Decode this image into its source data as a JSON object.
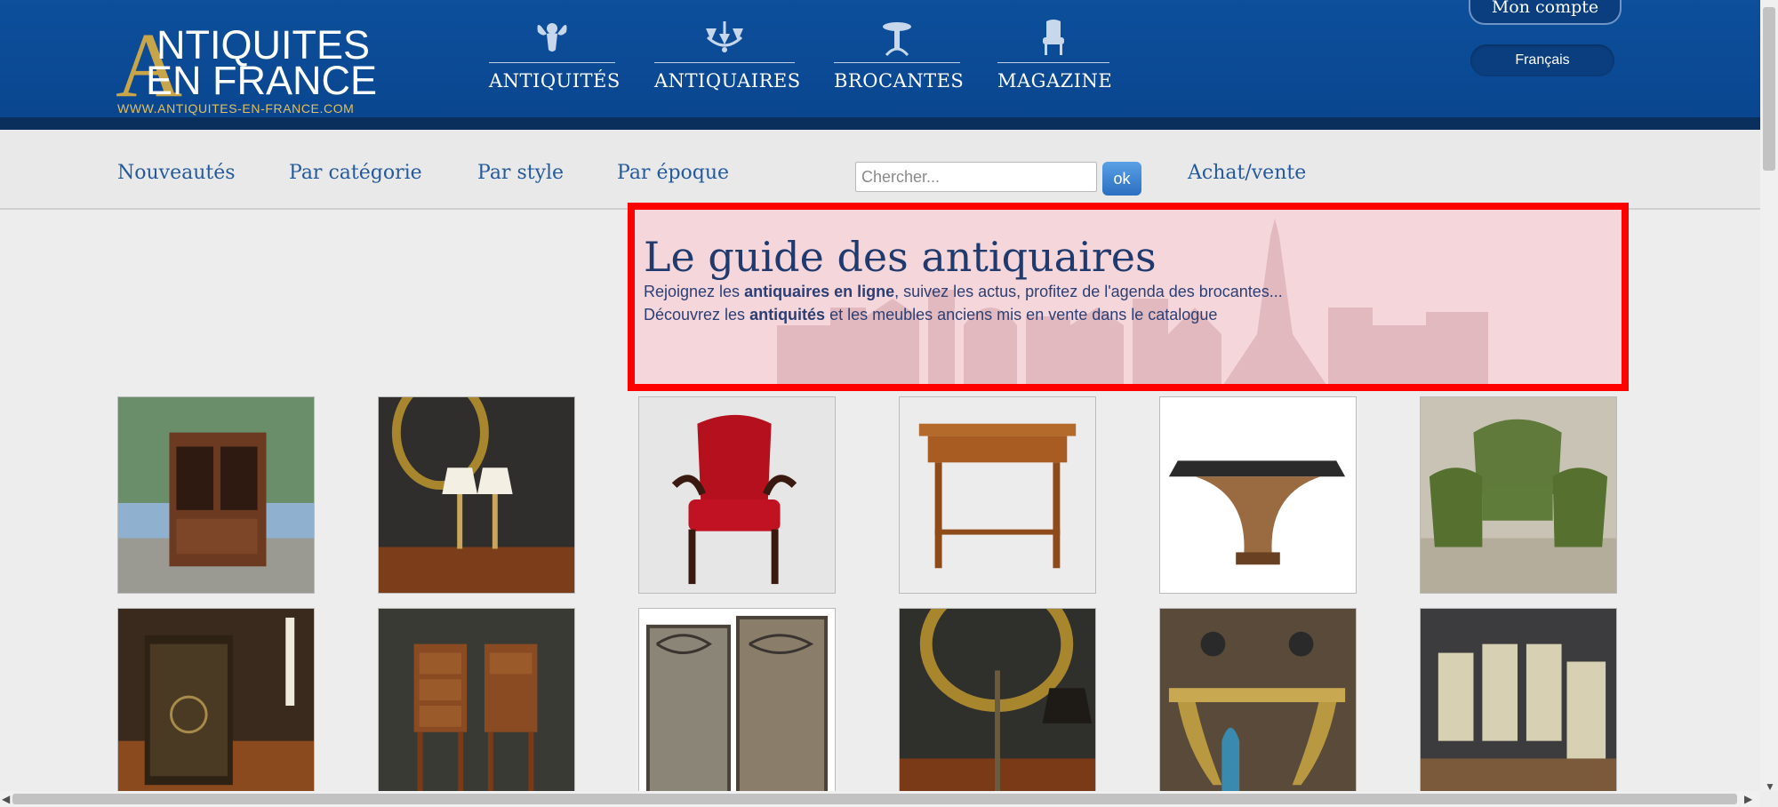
{
  "header": {
    "logo": {
      "letter": "A",
      "line1": "NTIQUITES",
      "line2": "EN FRANCE",
      "url": "WWW.ANTIQUITES-EN-FRANCE.COM"
    },
    "nav": [
      {
        "label": "ANTIQUITÉS",
        "icon": "cherub-icon"
      },
      {
        "label": "ANTIQUAIRES",
        "icon": "chandelier-icon"
      },
      {
        "label": "BROCANTES",
        "icon": "pedestal-table-icon"
      },
      {
        "label": "MAGAZINE",
        "icon": "armchair-icon"
      }
    ],
    "account_label": "Mon compte",
    "language_label": "Français"
  },
  "subnav": {
    "items": [
      "Nouveautés",
      "Par catégorie",
      "Par style",
      "Par époque"
    ],
    "search_placeholder": "Chercher...",
    "search_button": "ok",
    "achat_vente": "Achat/vente"
  },
  "hero": {
    "title": "Le guide des antiquaires",
    "line1_pre": "Rejoignez les ",
    "line1_bold": "antiquaires en ligne",
    "line1_post": ", suivez les actus, profitez de l'agenda des brocantes...",
    "line2_pre": "Découvrez les ",
    "line2_bold": "antiquités",
    "line2_post": " et les meubles anciens mis en vente dans le catalogue"
  },
  "colors": {
    "header_blue": "#0d4f9b",
    "link_blue": "#235a9c",
    "gold": "#c9a54a",
    "highlight_red": "#ff0000"
  },
  "products": [
    {
      "name": "bookcase-cabinet"
    },
    {
      "name": "brass-lamps-pair"
    },
    {
      "name": "red-armchair"
    },
    {
      "name": "wooden-side-table"
    },
    {
      "name": "glass-top-table"
    },
    {
      "name": "green-armchairs-set"
    },
    {
      "name": "leather-book-box"
    },
    {
      "name": "nightstands-pair"
    },
    {
      "name": "iron-gates"
    },
    {
      "name": "gilt-mirror"
    },
    {
      "name": "console-bronzes"
    },
    {
      "name": "painted-armchairs"
    }
  ]
}
